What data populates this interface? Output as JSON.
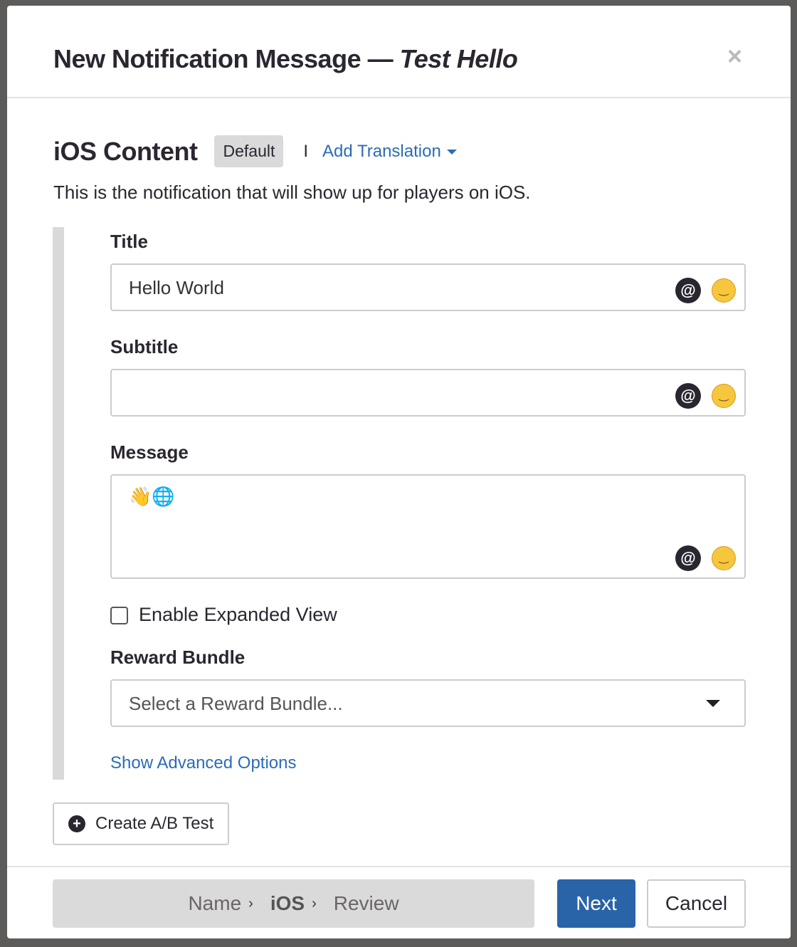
{
  "modal": {
    "title": "New Notification Message",
    "title_dash": " — ",
    "title_name": "Test Hello",
    "close": "×"
  },
  "section": {
    "heading": "iOS Content",
    "badge": "Default",
    "separator": "I",
    "add_translation": "Add Translation",
    "description": "This is the notification that will show up for players on iOS."
  },
  "fields": {
    "title": {
      "label": "Title",
      "value": "Hello World"
    },
    "subtitle": {
      "label": "Subtitle",
      "value": ""
    },
    "message": {
      "label": "Message",
      "value": "👋🌐"
    },
    "at_icon": "@",
    "emoji_icon": "😄"
  },
  "expanded_view": {
    "label": "Enable Expanded View",
    "checked": false
  },
  "reward": {
    "label": "Reward Bundle",
    "placeholder": "Select a Reward Bundle..."
  },
  "advanced": "Show Advanced Options",
  "ab_test": "Create A/B Test",
  "steps": [
    "Name",
    "iOS",
    "Review"
  ],
  "step_current": "iOS",
  "buttons": {
    "next": "Next",
    "cancel": "Cancel"
  },
  "colors": {
    "primary": "#2a64a8",
    "link": "#2b6cb8"
  }
}
